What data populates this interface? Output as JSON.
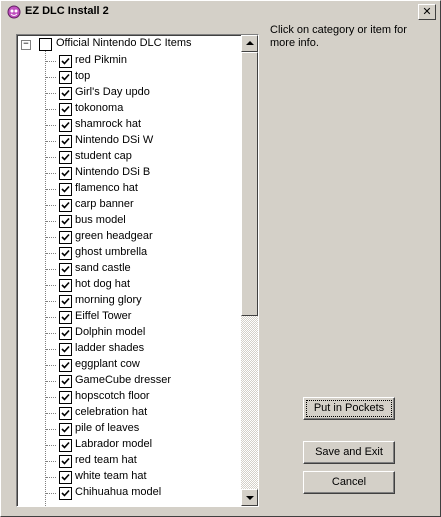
{
  "window": {
    "title": "EZ DLC Install 2",
    "close_glyph": "✕"
  },
  "tree": {
    "root": {
      "label": "Official Nintendo DLC Items",
      "expander": "−",
      "checked": false
    },
    "items": [
      {
        "label": "red Pikmin",
        "checked": true
      },
      {
        "label": "top",
        "checked": true
      },
      {
        "label": "Girl's Day updo",
        "checked": true
      },
      {
        "label": "tokonoma",
        "checked": true
      },
      {
        "label": "shamrock hat",
        "checked": true
      },
      {
        "label": "Nintendo DSi W",
        "checked": true
      },
      {
        "label": "student cap",
        "checked": true
      },
      {
        "label": "Nintendo DSi B",
        "checked": true
      },
      {
        "label": "flamenco hat",
        "checked": true
      },
      {
        "label": "carp banner",
        "checked": true
      },
      {
        "label": "bus model",
        "checked": true
      },
      {
        "label": "green headgear",
        "checked": true
      },
      {
        "label": "ghost umbrella",
        "checked": true
      },
      {
        "label": "sand castle",
        "checked": true
      },
      {
        "label": "hot dog hat",
        "checked": true
      },
      {
        "label": "morning glory",
        "checked": true
      },
      {
        "label": "Eiffel Tower",
        "checked": true
      },
      {
        "label": "Dolphin model",
        "checked": true
      },
      {
        "label": "ladder shades",
        "checked": true
      },
      {
        "label": "eggplant cow",
        "checked": true
      },
      {
        "label": "GameCube dresser",
        "checked": true
      },
      {
        "label": "hopscotch floor",
        "checked": true
      },
      {
        "label": "celebration hat",
        "checked": true
      },
      {
        "label": "pile of leaves",
        "checked": true
      },
      {
        "label": "Labrador model",
        "checked": true
      },
      {
        "label": "red team hat",
        "checked": true
      },
      {
        "label": "white team hat",
        "checked": true
      },
      {
        "label": "Chihuahua model",
        "checked": true
      }
    ]
  },
  "help_text": "Click on category or item for more info.",
  "buttons": {
    "put_in_pockets": "Put in Pockets",
    "save_and_exit": "Save and Exit",
    "cancel": "Cancel"
  },
  "icons": {
    "app": "app-icon",
    "close": "close-icon",
    "checkmark": "checkmark-icon"
  }
}
